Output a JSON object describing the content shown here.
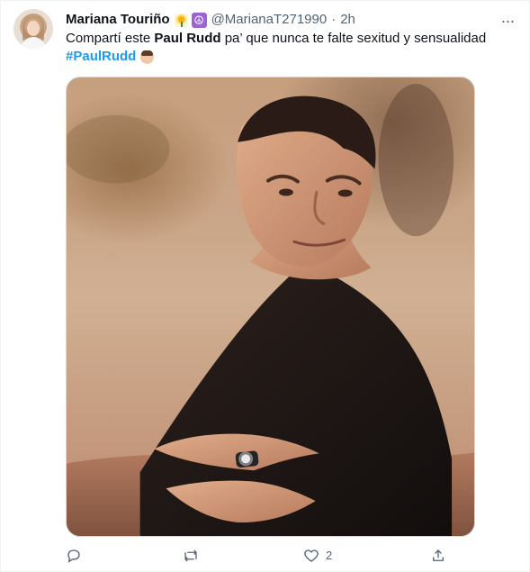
{
  "tweet": {
    "display_name": "Mariana Touriño",
    "handle": "@MarianaT271990",
    "separator": "·",
    "time": "2h",
    "more_label": "···",
    "text_prefix": "Compartí este ",
    "text_bold": "Paul Rudd",
    "text_suffix": " pa’ que nunca te falte sexitud y sensualidad",
    "hashtag": "#PaulRudd"
  },
  "actions": {
    "likes": "2"
  },
  "icons": {
    "avatar": "profile-photo-icon",
    "verified_emoji": "flower-emoji-icon",
    "peace_emoji": "peace-symbol-icon",
    "more": "more-dots-icon",
    "reply": "reply-icon",
    "retweet": "retweet-icon",
    "like": "heart-icon",
    "share": "share-icon"
  },
  "colors": {
    "text": "#0f1419",
    "secondary": "#536471",
    "hashtag": "#1d9bf0",
    "border": "#cfd9de"
  }
}
